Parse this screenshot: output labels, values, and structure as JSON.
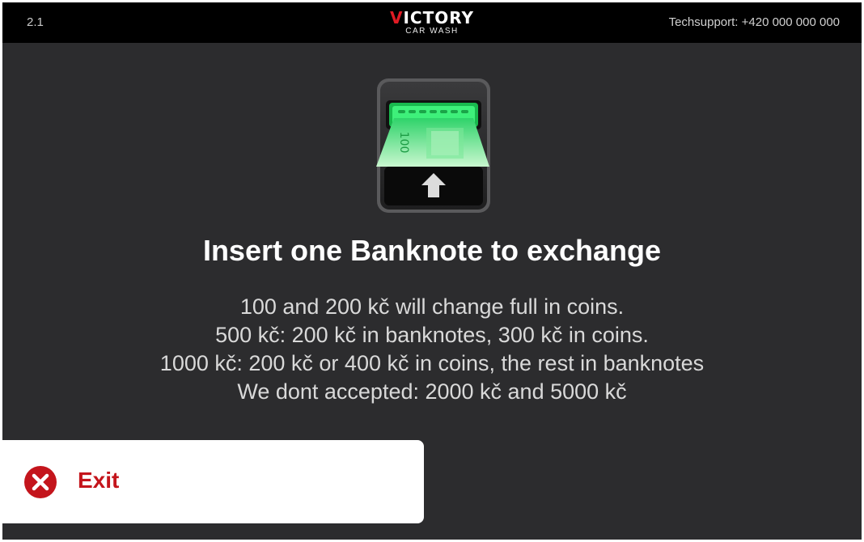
{
  "header": {
    "version": "2.1",
    "logo_main_first": "V",
    "logo_main_rest": "ICTORY",
    "logo_sub": "CAR WASH",
    "support": "Techsupport: +420 000 000 000"
  },
  "illustration": {
    "banknote_value": "100",
    "icon": "banknote-insert-icon"
  },
  "main": {
    "title": "Insert one Banknote to exchange",
    "lines": [
      "100 and 200 kč will change full in coins.",
      "500 kč: 200 kč in banknotes, 300 kč in coins.",
      "1000 kč: 200 kč or 400 kč in coins, the rest in banknotes",
      "We dont accepted: 2000 kč and 5000 kč"
    ]
  },
  "exit_button": {
    "label": "Exit",
    "icon": "close-circle-icon"
  },
  "colors": {
    "background": "#2c2c2e",
    "topbar": "#000000",
    "accent_red": "#c4151c",
    "note_green": "#27d96a"
  }
}
